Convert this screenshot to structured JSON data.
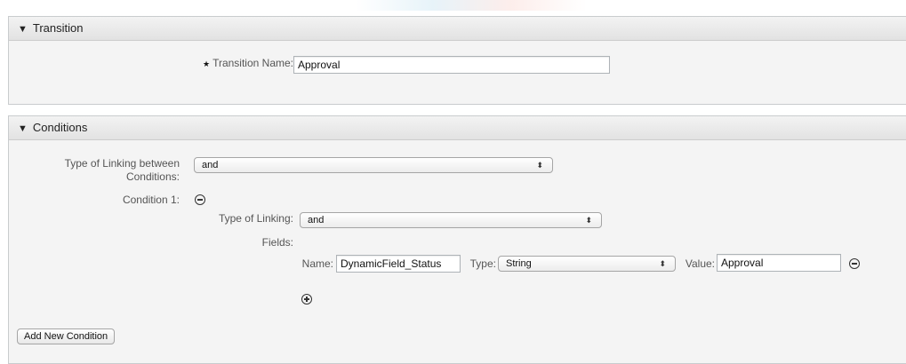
{
  "transition_panel": {
    "header": "Transition",
    "name_label": "Transition Name:",
    "name_value": "Approval"
  },
  "conditions_panel": {
    "header": "Conditions",
    "linking_between_label_line1": "Type of Linking between",
    "linking_between_label_line2": "Conditions:",
    "linking_between_value": "and",
    "condition1_label": "Condition 1:",
    "type_of_linking_label": "Type of Linking:",
    "type_of_linking_value": "and",
    "fields_label": "Fields:",
    "field_row": {
      "name_label": "Name:",
      "name_value": "DynamicField_Status",
      "type_label": "Type:",
      "type_value": "String",
      "value_label": "Value:",
      "value_value": "Approval"
    },
    "add_condition_button": "Add New Condition"
  },
  "icons": {
    "collapse": "triangle-down-icon",
    "remove": "minus-circle-icon",
    "add": "plus-circle-icon",
    "select_arrows": "updown-arrows-icon",
    "required": "star-icon"
  }
}
